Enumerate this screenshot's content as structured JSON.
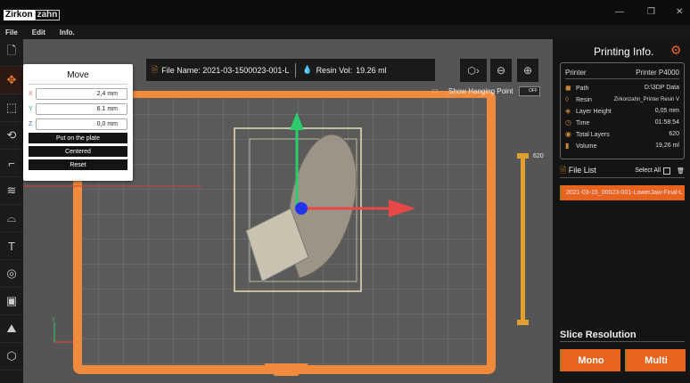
{
  "app": {
    "logo_left": "Zirkon",
    "logo_right": "zahn",
    "minimize": "—",
    "restore": "❐",
    "close": "✕"
  },
  "menu": [
    "File",
    "Edit",
    "Info."
  ],
  "topbar": {
    "file_name_label": "File Name: 2021-03-1500023-001-L",
    "resin_vol_label": "Resin Vol:",
    "resin_vol_value": "19.26 ml",
    "hanging_point_label": "Show Hanging Point",
    "hanging_toggle": "OFF"
  },
  "move": {
    "title": "Move",
    "x_label": "X",
    "x_value": "2,4 mm",
    "y_label": "Y",
    "y_value": "6.1 mm",
    "z_label": "Z",
    "z_value": "0,0 mm",
    "put_on_plate": "Put on the plate",
    "centered": "Centered",
    "reset": "Reset"
  },
  "layer_slider": {
    "max_label": "620",
    "value_fraction": 1.0
  },
  "axis": {
    "y": "Y",
    "x": "X"
  },
  "printing": {
    "title": "Printing Info.",
    "printer_label": "Printer",
    "printer_value": "Printer P4000",
    "rows": [
      {
        "label": "Path",
        "value": "D:\\3DP Data",
        "icon": "◼"
      },
      {
        "label": "Resin",
        "value": "Zirkonzahn_Printer Resin V",
        "icon": "◊"
      },
      {
        "label": "Layer Height",
        "value": "0,05 mm",
        "icon": "◈"
      },
      {
        "label": "Time",
        "value": "01:58:54",
        "icon": "◷"
      },
      {
        "label": "Total Layers",
        "value": "620",
        "icon": "◉"
      },
      {
        "label": "Volume",
        "value": "19,26 ml",
        "icon": "▮"
      }
    ]
  },
  "file_list": {
    "title": "File List",
    "select_all": "Select All",
    "files": [
      "2021-03-15_00023-001-LowerJaw-Final-L"
    ]
  },
  "slice": {
    "title": "Slice Resolution",
    "mono": "Mono",
    "multi": "Multi"
  },
  "colors": {
    "accent": "#e8641e",
    "panel": "#141414",
    "viewport": "#555555"
  }
}
